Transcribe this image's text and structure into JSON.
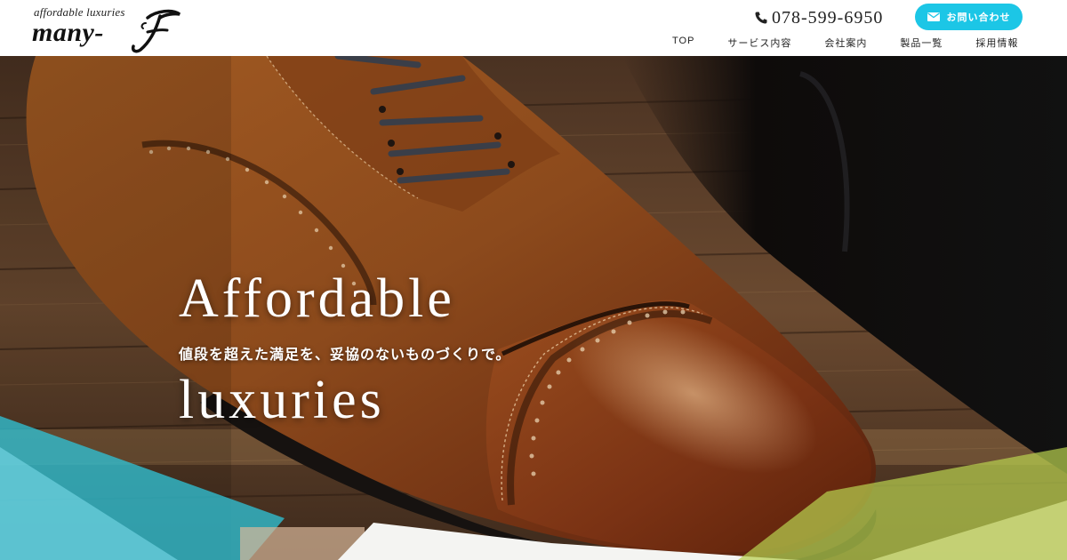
{
  "brand": {
    "tagline": "affordable luxuries",
    "name": "many-"
  },
  "header": {
    "phone": "078-599-6950",
    "contact_label": "お問い合わせ"
  },
  "nav": {
    "items": [
      {
        "label": "TOP"
      },
      {
        "label": "サービス内容"
      },
      {
        "label": "会社案内"
      },
      {
        "label": "製品一覧"
      },
      {
        "label": "採用情報"
      }
    ]
  },
  "hero": {
    "title_line1": "Affordable",
    "subtitle": "値段を超えた満足を、妥協のないものづくりで。",
    "title_line2": "luxuries"
  },
  "colors": {
    "accent": "#1cc6e6",
    "leather": "#8a4a1c",
    "teal_overlay": "#3fc6d6",
    "lime_overlay": "#bfd35a"
  },
  "icons": {
    "phone": "phone-icon",
    "mail": "mail-icon"
  }
}
